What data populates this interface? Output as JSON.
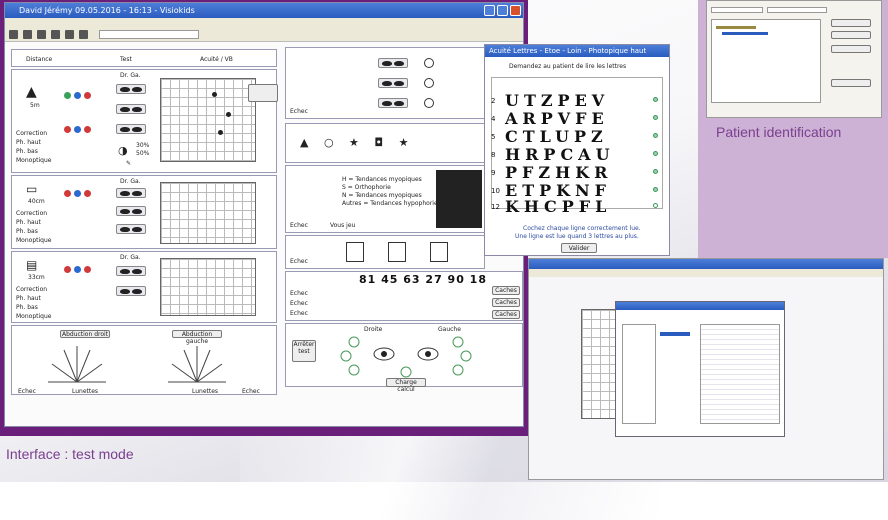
{
  "captions": {
    "interface_test_mode": "Interface : test mode",
    "patient_identification": "Patient identification"
  },
  "main_window": {
    "title": "David Jérémy  09.05.2016 - 16:13 - Visiokids"
  },
  "sections": {
    "distance_label": "Distance",
    "test_label": "Test",
    "acuity_label": "Acuité / VB",
    "eye_header": "Dr.  Ga.",
    "distance_far": "5m",
    "distance_mid": "40cm",
    "distance_near": "33cm",
    "options": [
      "Correction",
      "Ph. haut",
      "Ph. bas",
      "Monoptique"
    ],
    "options_mid": [
      "Correction",
      "Ph. haut",
      "Ph. bas",
      "Monoptique"
    ],
    "options_near": [
      "Correction",
      "Ph. haut",
      "Ph. bas",
      "Monoptique"
    ],
    "percent_a": "30%",
    "percent_b": "50%",
    "abduction_right": "Abduction droit",
    "abduction_left": "Abduction gauche",
    "echec": "Echec",
    "lunettes": "Lunettes",
    "droite": "Droite",
    "gauche": "Gauche",
    "charge_button": "Charge calcul",
    "arreter_button": "Arrêter test",
    "tendances": [
      "H = Tendances myopiques",
      "S = Orthophorie",
      "N = Tendances myopiques",
      "Autres = Tendances hypophories"
    ],
    "vous_jeu": "Vous jeu",
    "numbers_row": "81  45  63  27  90  18",
    "vol_buttons": [
      "Caches",
      "Caches",
      "Caches"
    ]
  },
  "letters_window": {
    "title": "Acuité Lettres - Etoe - Loin - Photopique haut",
    "instruction": "Demandez au patient de lire les lettres",
    "rows": [
      {
        "num": "2",
        "letters": "UTZPEV"
      },
      {
        "num": "4",
        "letters": "ARPVFE"
      },
      {
        "num": "5",
        "letters": "CTLUPZ"
      },
      {
        "num": "8",
        "letters": "HRPCAU"
      },
      {
        "num": "9",
        "letters": "PFZHKR"
      },
      {
        "num": "10",
        "letters": "ETPKNF"
      },
      {
        "num": "12",
        "letters": "KHCPFL"
      }
    ],
    "footer_1": "Cochez chaque ligne correctement lue.",
    "footer_2": "Une ligne est lue quand 3 lettres au plus.",
    "validate": "Valider"
  },
  "colors": {
    "purple_frame": "#6a1f7a",
    "caption_purple": "#7a3f8f",
    "light_purple": "#cdb2d6"
  }
}
